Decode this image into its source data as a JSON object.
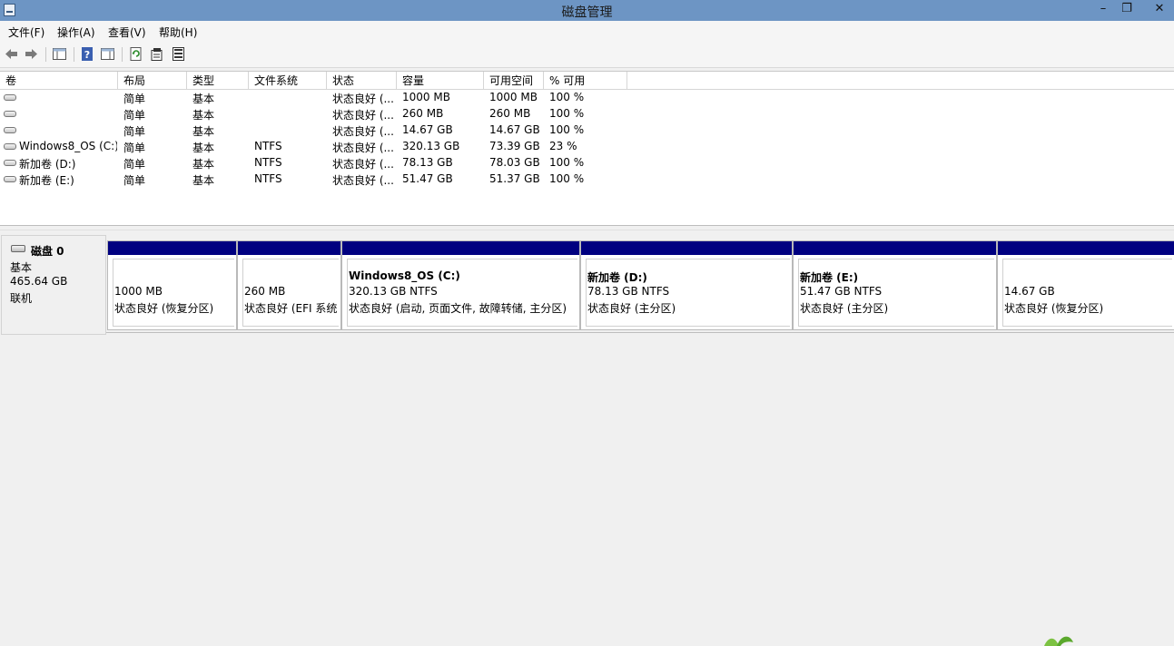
{
  "window": {
    "title": "磁盘管理",
    "minimize_glyph": "–",
    "restore_glyph": "❐",
    "close_glyph": "✕"
  },
  "menu": {
    "file": "文件(F)",
    "action": "操作(A)",
    "view": "查看(V)",
    "help": "帮助(H)"
  },
  "toolbar_icons": [
    "back-icon",
    "forward-icon",
    "show-hide-tree-icon",
    "help-icon",
    "show-hide-action-pane-icon",
    "refresh-icon",
    "properties-icon",
    "export-list-icon"
  ],
  "columns": [
    "卷",
    "布局",
    "类型",
    "文件系统",
    "状态",
    "容量",
    "可用空间",
    "% 可用"
  ],
  "volumes": [
    {
      "name": "",
      "layout": "简单",
      "type": "基本",
      "fs": "",
      "status": "状态良好 (...",
      "capacity": "1000 MB",
      "free": "1000 MB",
      "pct": "100 %"
    },
    {
      "name": "",
      "layout": "简单",
      "type": "基本",
      "fs": "",
      "status": "状态良好 (...",
      "capacity": "260 MB",
      "free": "260 MB",
      "pct": "100 %"
    },
    {
      "name": "",
      "layout": "简单",
      "type": "基本",
      "fs": "",
      "status": "状态良好 (...",
      "capacity": "14.67 GB",
      "free": "14.67 GB",
      "pct": "100 %"
    },
    {
      "name": "Windows8_OS (C:)",
      "layout": "简单",
      "type": "基本",
      "fs": "NTFS",
      "status": "状态良好 (...",
      "capacity": "320.13 GB",
      "free": "73.39 GB",
      "pct": "23 %"
    },
    {
      "name": "新加卷 (D:)",
      "layout": "简单",
      "type": "基本",
      "fs": "NTFS",
      "status": "状态良好 (...",
      "capacity": "78.13 GB",
      "free": "78.03 GB",
      "pct": "100 %"
    },
    {
      "name": "新加卷 (E:)",
      "layout": "简单",
      "type": "基本",
      "fs": "NTFS",
      "status": "状态良好 (...",
      "capacity": "51.47 GB",
      "free": "51.37 GB",
      "pct": "100 %"
    }
  ],
  "disk": {
    "name": "磁盘 0",
    "type": "基本",
    "size": "465.64 GB",
    "state": "联机"
  },
  "partitions": [
    {
      "label": "",
      "size": "1000 MB",
      "status": "状态良好 (恢复分区)"
    },
    {
      "label": "",
      "size": "260 MB",
      "status": "状态良好 (EFI 系统"
    },
    {
      "label": "Windows8_OS  (C:)",
      "size": "320.13 GB NTFS",
      "status": "状态良好 (启动, 页面文件, 故障转储, 主分区)"
    },
    {
      "label": "新加卷  (D:)",
      "size": "78.13 GB NTFS",
      "status": "状态良好 (主分区)"
    },
    {
      "label": "新加卷  (E:)",
      "size": "51.47 GB NTFS",
      "status": "状态良好 (主分区)"
    },
    {
      "label": "",
      "size": "14.67 GB",
      "status": "状态良好 (恢复分区)"
    }
  ],
  "colors": {
    "titlebar": "#6d95c4",
    "partition_bar": "#000080"
  }
}
